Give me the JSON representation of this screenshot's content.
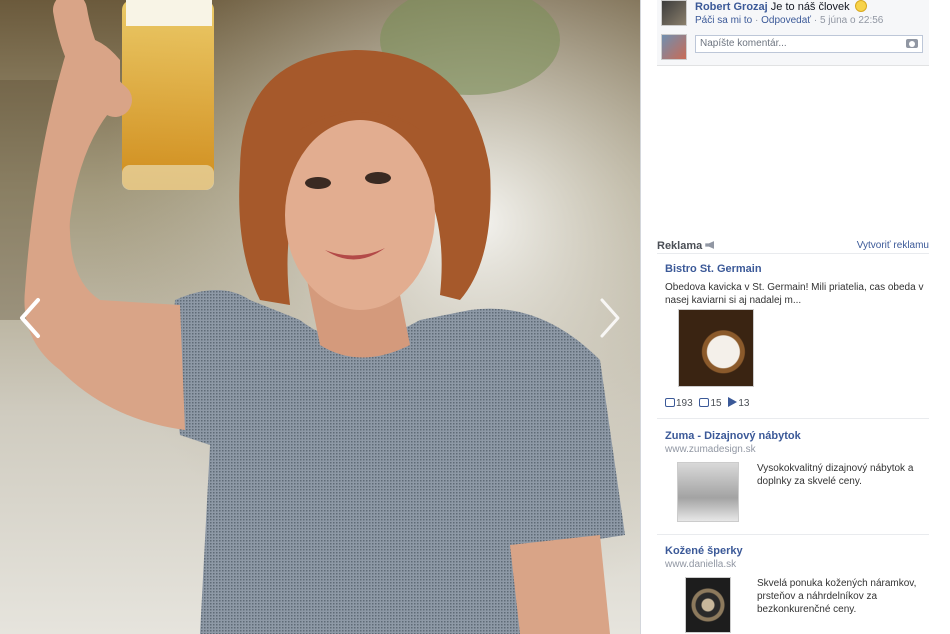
{
  "comment": {
    "author": "Robert Grozaj",
    "text": "Je to náš človek",
    "like_label": "Páči sa mi to",
    "reply_label": "Odpovedať",
    "timestamp": "5 júna o 22:56",
    "input_placeholder": "Napíšte komentár..."
  },
  "ads": {
    "header": "Reklama",
    "create_label": "Vytvoriť reklamu",
    "items": [
      {
        "title": "Bistro St. Germain",
        "text": "Obedova kavicka v St. Germain! Mili priatelia, cas obeda v nasej kaviarni si aj nadalej m...",
        "stats": {
          "likes": "193",
          "comments": "15",
          "shares": "13"
        }
      },
      {
        "title": "Zuma - Dizajnový nábytok",
        "domain": "www.zumadesign.sk",
        "text": "Vysokokvalitný dizajnový nábytok a doplnky za skvelé ceny."
      },
      {
        "title": "Kožené šperky",
        "domain": "www.daniella.sk",
        "text": "Skvelá ponuka kožených náramkov, prsteňov a náhrdelníkov za bezkonkurenčné ceny."
      }
    ]
  },
  "colors": {
    "link": "#3b5998",
    "muted": "#9197a3",
    "sidebar_bg": "#ffffff",
    "comment_bg": "#f6f7f9"
  },
  "icons": {
    "prev": "chevron-left-icon",
    "next": "chevron-right-icon",
    "camera": "camera-icon",
    "megaphone": "megaphone-icon",
    "like": "like-icon",
    "comment": "comment-icon",
    "share": "share-icon"
  }
}
